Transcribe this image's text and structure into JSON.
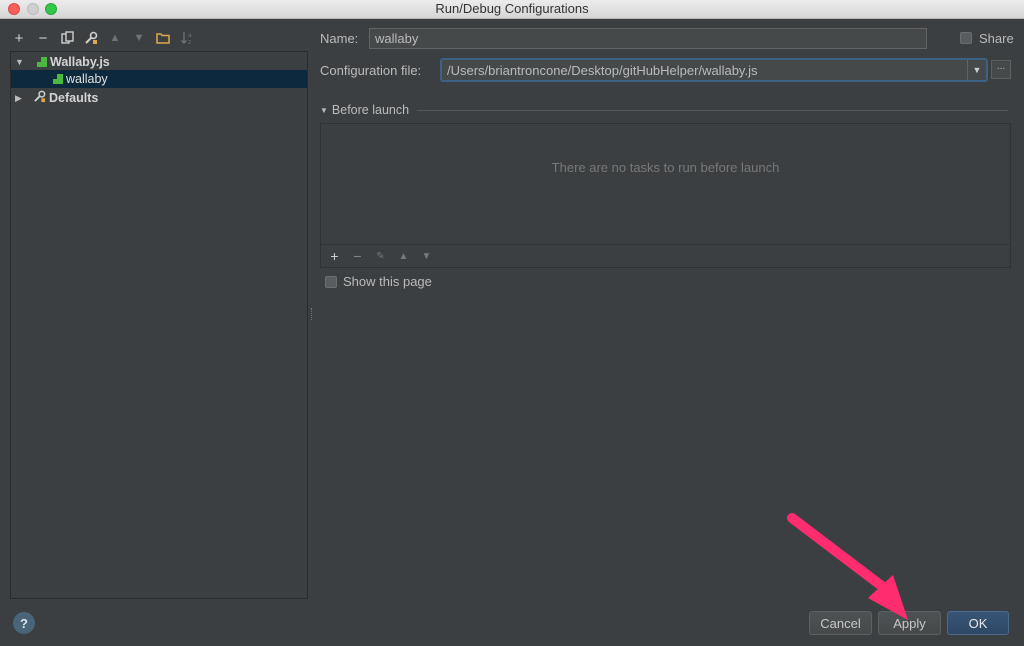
{
  "window": {
    "title": "Run/Debug Configurations"
  },
  "toolbar": {
    "icons": [
      "add-icon",
      "remove-icon",
      "copy-icon",
      "edit-defaults-icon",
      "move-up-icon",
      "move-down-icon",
      "folder-icon",
      "sort-icon"
    ],
    "add": "+",
    "remove": "−"
  },
  "tree": {
    "group_label": "Wallaby.js",
    "child_label": "wallaby",
    "defaults_label": "Defaults"
  },
  "form": {
    "name_label": "Name:",
    "name_value": "wallaby",
    "share_label": "Share",
    "config_file_label": "Configuration file:",
    "config_file_value": "/Users/briantroncone/Desktop/gitHubHelper/wallaby.js",
    "browse_label": "..."
  },
  "before_launch": {
    "title": "Before launch",
    "empty_text": "There are no tasks to run before launch",
    "add": "+",
    "remove": "−",
    "show_page_label": "Show this page"
  },
  "footer": {
    "help_label": "?",
    "cancel_label": "Cancel",
    "apply_label": "Apply",
    "ok_label": "OK"
  },
  "colors": {
    "background": "#3c3f41",
    "selection": "#0d293e",
    "accent_arrow": "#ff2d6f",
    "wallaby_green": "#4ab93f"
  }
}
